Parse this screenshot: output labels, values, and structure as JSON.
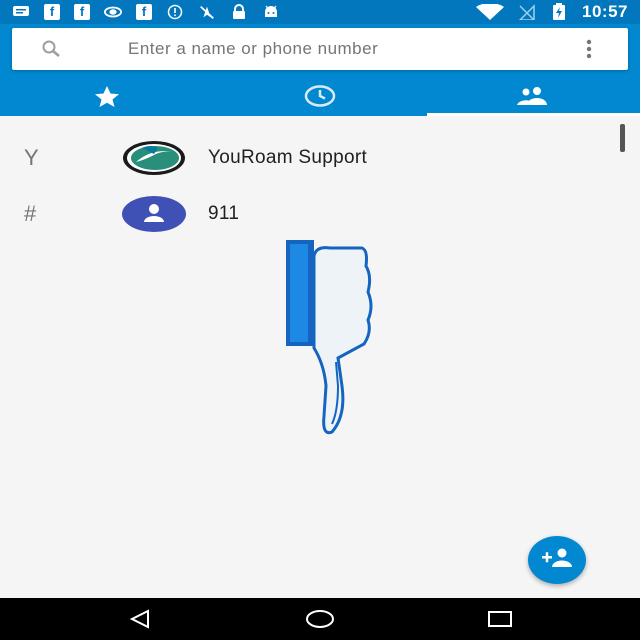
{
  "status_bar": {
    "time": "10:57",
    "left_icons": [
      "message-icon",
      "facebook-icon",
      "facebook-icon",
      "nvidia-icon",
      "facebook-icon",
      "info-icon",
      "no-location-icon",
      "lock-icon",
      "android-icon"
    ],
    "right_icons": [
      "wifi-icon",
      "no-signal-icon",
      "battery-charging-icon"
    ],
    "fb_letter": "f"
  },
  "search": {
    "placeholder": "Enter a name or phone number"
  },
  "tabs": [
    {
      "name": "favorites",
      "icon": "star-icon",
      "active": false
    },
    {
      "name": "recents",
      "icon": "clock-icon",
      "active": false
    },
    {
      "name": "contacts",
      "icon": "people-icon",
      "active": true
    }
  ],
  "contacts": [
    {
      "section": "Y",
      "name": "YouRoam Support",
      "avatar": "youroam-logo-icon"
    },
    {
      "section": "#",
      "name": "911",
      "avatar": "person-icon"
    }
  ],
  "colors": {
    "primary": "#0288d1",
    "status_bar": "#0277bd",
    "avatar_blue": "#3f51b5"
  },
  "fab": {
    "icon": "add-contact-icon"
  }
}
